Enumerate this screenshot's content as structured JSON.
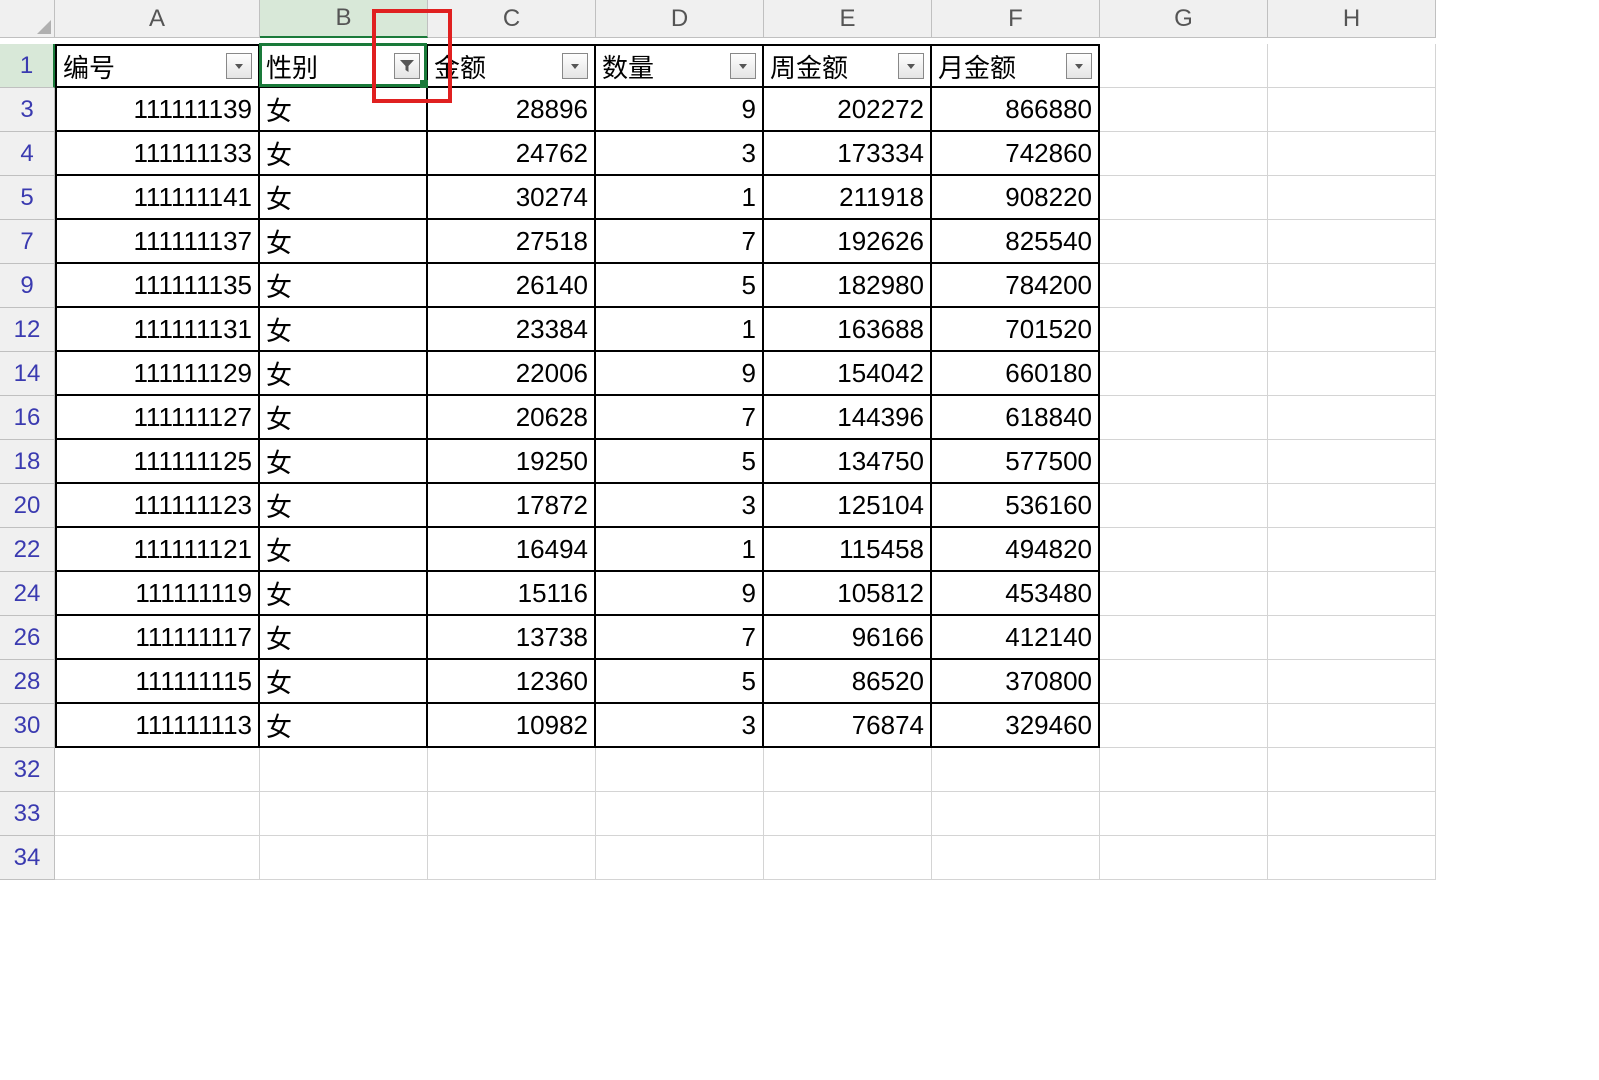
{
  "columns": [
    "A",
    "B",
    "C",
    "D",
    "E",
    "F",
    "G",
    "H"
  ],
  "selected_column_index": 1,
  "headers": {
    "A": "编号",
    "B": "性别",
    "C": "金额",
    "D": "数量",
    "E": "周金额",
    "F": "月金额"
  },
  "filter_active_column": "B",
  "visible_row_numbers": [
    1,
    3,
    4,
    5,
    7,
    9,
    12,
    14,
    16,
    18,
    20,
    22,
    24,
    26,
    28,
    30,
    32,
    33,
    34
  ],
  "rows": [
    {
      "rn": 3,
      "A": "111111139",
      "B": "女",
      "C": "28896",
      "D": "9",
      "E": "202272",
      "F": "866880"
    },
    {
      "rn": 4,
      "A": "111111133",
      "B": "女",
      "C": "24762",
      "D": "3",
      "E": "173334",
      "F": "742860"
    },
    {
      "rn": 5,
      "A": "111111141",
      "B": "女",
      "C": "30274",
      "D": "1",
      "E": "211918",
      "F": "908220"
    },
    {
      "rn": 7,
      "A": "111111137",
      "B": "女",
      "C": "27518",
      "D": "7",
      "E": "192626",
      "F": "825540"
    },
    {
      "rn": 9,
      "A": "111111135",
      "B": "女",
      "C": "26140",
      "D": "5",
      "E": "182980",
      "F": "784200"
    },
    {
      "rn": 12,
      "A": "111111131",
      "B": "女",
      "C": "23384",
      "D": "1",
      "E": "163688",
      "F": "701520"
    },
    {
      "rn": 14,
      "A": "111111129",
      "B": "女",
      "C": "22006",
      "D": "9",
      "E": "154042",
      "F": "660180"
    },
    {
      "rn": 16,
      "A": "111111127",
      "B": "女",
      "C": "20628",
      "D": "7",
      "E": "144396",
      "F": "618840"
    },
    {
      "rn": 18,
      "A": "111111125",
      "B": "女",
      "C": "19250",
      "D": "5",
      "E": "134750",
      "F": "577500"
    },
    {
      "rn": 20,
      "A": "111111123",
      "B": "女",
      "C": "17872",
      "D": "3",
      "E": "125104",
      "F": "536160"
    },
    {
      "rn": 22,
      "A": "111111121",
      "B": "女",
      "C": "16494",
      "D": "1",
      "E": "115458",
      "F": "494820"
    },
    {
      "rn": 24,
      "A": "111111119",
      "B": "女",
      "C": "15116",
      "D": "9",
      "E": "105812",
      "F": "453480"
    },
    {
      "rn": 26,
      "A": "111111117",
      "B": "女",
      "C": "13738",
      "D": "7",
      "E": "96166",
      "F": "412140"
    },
    {
      "rn": 28,
      "A": "111111115",
      "B": "女",
      "C": "12360",
      "D": "5",
      "E": "86520",
      "F": "370800"
    },
    {
      "rn": 30,
      "A": "111111113",
      "B": "女",
      "C": "10982",
      "D": "3",
      "E": "76874",
      "F": "329460"
    }
  ],
  "empty_trailing_rows": [
    32,
    33,
    34
  ],
  "selected_cell": {
    "col": "B",
    "row": 1
  },
  "annotation_box_around_filter": true
}
